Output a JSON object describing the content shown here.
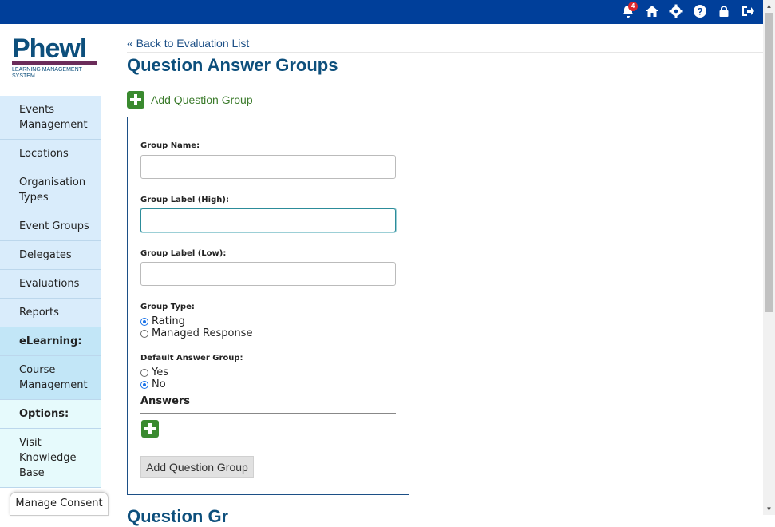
{
  "topbar": {
    "notification_count": "4",
    "icons": [
      "bell-icon",
      "home-icon",
      "gear-icon",
      "help-icon",
      "lock-icon",
      "logout-icon"
    ]
  },
  "logo": {
    "name": "Phewl",
    "subtitle": "LEARNING MANAGEMENT SYSTEM"
  },
  "sidebar": {
    "items": [
      {
        "label": "Events Management"
      },
      {
        "label": "Locations"
      },
      {
        "label": "Organisation Types"
      },
      {
        "label": "Event Groups"
      },
      {
        "label": "Delegates"
      },
      {
        "label": "Evaluations"
      },
      {
        "label": "Reports"
      },
      {
        "label": "eLearning:"
      },
      {
        "label": "Course Management"
      },
      {
        "label": "Options:"
      },
      {
        "label": "Visit Knowledge Base"
      }
    ],
    "consent_label": "Manage Consent"
  },
  "main": {
    "back_link": "« Back to Evaluation List",
    "title": "Question Answer Groups",
    "add_group_label": "Add Question Group",
    "next_section_title": "Question Gr"
  },
  "form": {
    "group_name_label": "Group Name:",
    "group_name_value": "",
    "label_high_label": "Group Label (High):",
    "label_high_value": "",
    "label_low_label": "Group Label (Low):",
    "label_low_value": "",
    "group_type_label": "Group Type:",
    "group_type_options": [
      "Rating",
      "Managed Response"
    ],
    "group_type_selected": "Rating",
    "default_label": "Default Answer Group:",
    "default_options": [
      "Yes",
      "No"
    ],
    "default_selected": "No",
    "answers_heading": "Answers",
    "submit_label": "Add Question Group"
  },
  "colors": {
    "topbar": "#003f9a",
    "brand": "#0d4f7c",
    "accent_green": "#3a8a2f",
    "nav_bg": "#d9ecfb"
  }
}
